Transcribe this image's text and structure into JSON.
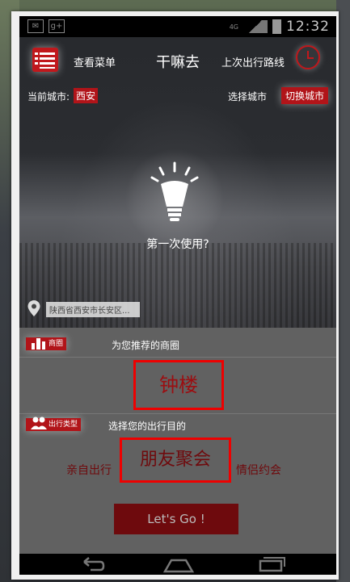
{
  "status_bar": {
    "network": "4G",
    "time": "12:32"
  },
  "header": {
    "menu_label": "查看菜单",
    "title": "干嘛去",
    "history_label": "上次出行路线"
  },
  "city": {
    "current_label": "当前城市:",
    "current_value": "西安",
    "choose_label": "选择城市",
    "switch_button": "切换城市"
  },
  "hero": {
    "prompt": "第一次使用?"
  },
  "location": {
    "address": "陕西省西安市长安区..."
  },
  "business_section": {
    "tag": "商圈",
    "label": "为您推荐的商圈",
    "selected": "钟楼"
  },
  "trip_section": {
    "tag": "出行类型",
    "label": "选择您的出行目的",
    "options": [
      "亲自出行",
      "朋友聚会",
      "情侣约会"
    ]
  },
  "go_button": "Let's Go !",
  "colors": {
    "accent": "#b11419",
    "highlight_border": "#ee0000"
  }
}
